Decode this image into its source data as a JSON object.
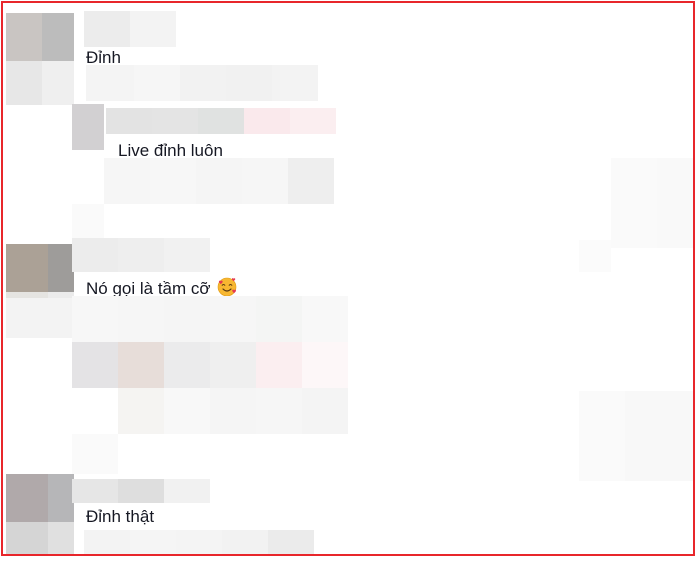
{
  "comments": [
    {
      "text": "Đỉnh"
    },
    {
      "text": "Live đỉnh luôn"
    },
    {
      "text": "Nó gọi là tầm cỡ",
      "emoji": "smiling-face-with-hearts-icon"
    },
    {
      "text": "Đỉnh thật"
    }
  ],
  "colors": {
    "frame_border": "#e8262b",
    "text": "#161823"
  }
}
